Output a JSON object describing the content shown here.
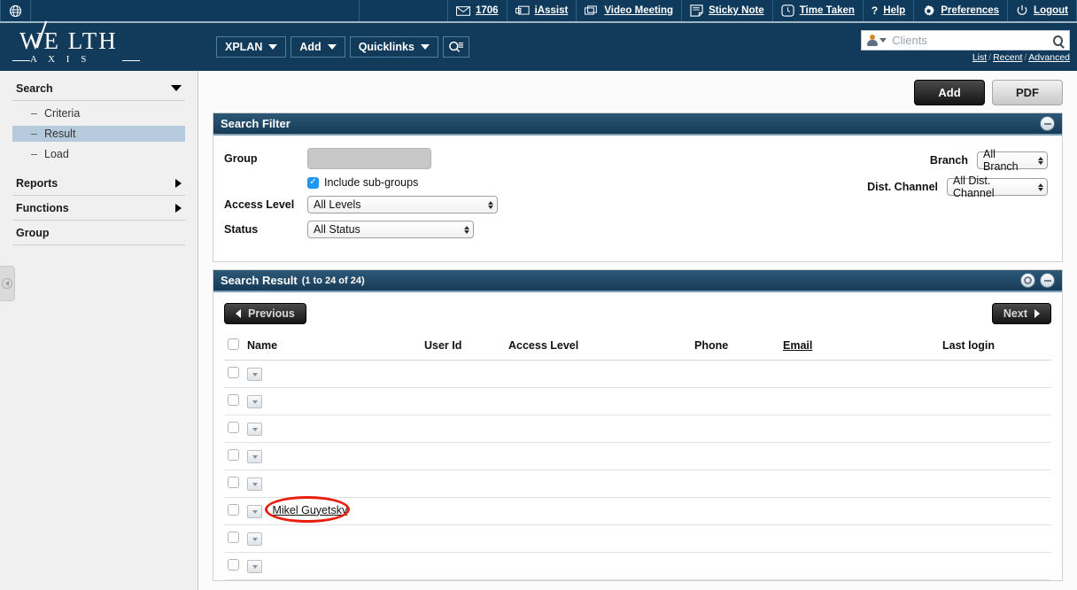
{
  "topbar": {
    "globe_icon": "globe-icon",
    "items": [
      {
        "icon": "mail-icon",
        "label": "1706",
        "name": "mail-count"
      },
      {
        "icon": "monitor-icon",
        "label": "iAssist",
        "name": "iassist"
      },
      {
        "icon": "video-icon",
        "label": "Video Meeting",
        "name": "video-meeting"
      },
      {
        "icon": "note-icon",
        "label": "Sticky Note",
        "name": "sticky-note"
      },
      {
        "icon": "clock-icon",
        "label": "Time Taken",
        "name": "time-taken"
      },
      {
        "icon": "question-icon",
        "label": "Help",
        "name": "help"
      },
      {
        "icon": "gear-icon",
        "label": "Preferences",
        "name": "preferences"
      },
      {
        "icon": "power-icon",
        "label": "Logout",
        "name": "logout"
      }
    ]
  },
  "brand": {
    "name_main": "WE LTH",
    "name_sub": "A X I S",
    "nav": [
      {
        "label": "XPLAN",
        "caret": true
      },
      {
        "label": "Add",
        "caret": true
      },
      {
        "label": "Quicklinks",
        "caret": true
      }
    ],
    "search_icon": "search-list-icon"
  },
  "search": {
    "placeholder": "Clients",
    "value": "",
    "links": [
      "List",
      "Recent",
      "Advanced"
    ],
    "avatar_icon": "person-icon",
    "magnifier_icon": "search-icon"
  },
  "sidebar": {
    "sections": [
      {
        "label": "Search",
        "expanded": true,
        "icon": "chevron-down-icon"
      },
      {
        "label": "Reports",
        "expanded": false,
        "icon": "chevron-right-icon"
      },
      {
        "label": "Functions",
        "expanded": false,
        "icon": "chevron-right-icon"
      },
      {
        "label": "Group",
        "expanded": false,
        "icon": ""
      }
    ],
    "search_items": [
      {
        "label": "Criteria",
        "active": false
      },
      {
        "label": "Result",
        "active": true
      },
      {
        "label": "Load",
        "active": false
      }
    ],
    "collapse_icon": "collapse-left-icon"
  },
  "actions": {
    "add_label": "Add",
    "pdf_label": "PDF"
  },
  "filter_panel": {
    "title": "Search Filter",
    "collapse_icon": "minus-circle-icon",
    "group_label": "Group",
    "group_value": "",
    "include_subgroups_label": "Include sub-groups",
    "include_subgroups_checked": true,
    "check_glyph": "✓",
    "access_level_label": "Access Level",
    "access_level_value": "All Levels",
    "status_label": "Status",
    "status_value": "All Status",
    "branch_label": "Branch",
    "branch_value": "All Branch",
    "dist_channel_label": "Dist. Channel",
    "dist_channel_value": "All Dist. Channel"
  },
  "result_panel": {
    "title": "Search Result",
    "count_text": "(1 to 24 of 24)",
    "refresh_icon": "settings-circle-icon",
    "collapse_icon": "minus-circle-icon",
    "previous_label": "Previous",
    "next_label": "Next",
    "columns": [
      {
        "label": "Name",
        "link": false
      },
      {
        "label": "User Id",
        "link": false
      },
      {
        "label": "Access Level",
        "link": false
      },
      {
        "label": "Phone",
        "link": false
      },
      {
        "label": "Email",
        "link": true
      },
      {
        "label": "Last login",
        "link": false
      }
    ],
    "rows": [
      {
        "name": "",
        "user_id": "",
        "access_level": "",
        "phone": "",
        "email": "",
        "last_login": "",
        "highlighted": false
      },
      {
        "name": "",
        "user_id": "",
        "access_level": "",
        "phone": "",
        "email": "",
        "last_login": "",
        "highlighted": false
      },
      {
        "name": "",
        "user_id": "",
        "access_level": "",
        "phone": "",
        "email": "",
        "last_login": "",
        "highlighted": false
      },
      {
        "name": "",
        "user_id": "",
        "access_level": "",
        "phone": "",
        "email": "",
        "last_login": "",
        "highlighted": false
      },
      {
        "name": "",
        "user_id": "",
        "access_level": "",
        "phone": "",
        "email": "",
        "last_login": "",
        "highlighted": false
      },
      {
        "name": "Mikel Guyetsky",
        "user_id": "",
        "access_level": "",
        "phone": "",
        "email": "",
        "last_login": "",
        "highlighted": true
      },
      {
        "name": "",
        "user_id": "",
        "access_level": "",
        "phone": "",
        "email": "",
        "last_login": "",
        "highlighted": false
      },
      {
        "name": "",
        "user_id": "",
        "access_level": "",
        "phone": "",
        "email": "",
        "last_login": "",
        "highlighted": false
      }
    ]
  },
  "colors": {
    "topbar_bg": "#0f3a5c",
    "brand_bg": "#123a5a",
    "panel_head": "#2d5877",
    "sidebar_bg": "#f0f0f0",
    "active_item": "#b6cade",
    "annotation": "#e81f0f",
    "checkbox_blue": "#2196f3"
  }
}
